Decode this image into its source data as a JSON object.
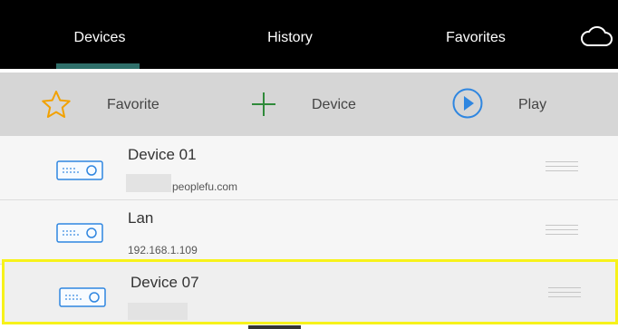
{
  "tabs": [
    {
      "label": "Devices",
      "active": true
    },
    {
      "label": "History",
      "active": false
    },
    {
      "label": "Favorites",
      "active": false
    }
  ],
  "toolbar": {
    "favorite_label": "Favorite",
    "device_label": "Device",
    "play_label": "Play"
  },
  "devices": [
    {
      "name": "Device 01",
      "address": "peoplefu.com"
    },
    {
      "name": "Lan",
      "address": "192.168.1.109"
    },
    {
      "name": "Device 07",
      "address": ""
    }
  ],
  "icons": {
    "top_right": "cloud-icon",
    "favorite": "star-icon",
    "device": "plus-icon",
    "play": "play-circle-icon",
    "device_row": "device-box-icon",
    "row_action": "drag-handle-icon"
  },
  "colors": {
    "header_bg": "#000000",
    "toolbar_bg": "#d6d6d6",
    "selected_border": "#f7f21a",
    "star": "#f2a100",
    "plus": "#2f8a3a",
    "play": "#2f86e0",
    "device_icon": "#2f86e0"
  }
}
